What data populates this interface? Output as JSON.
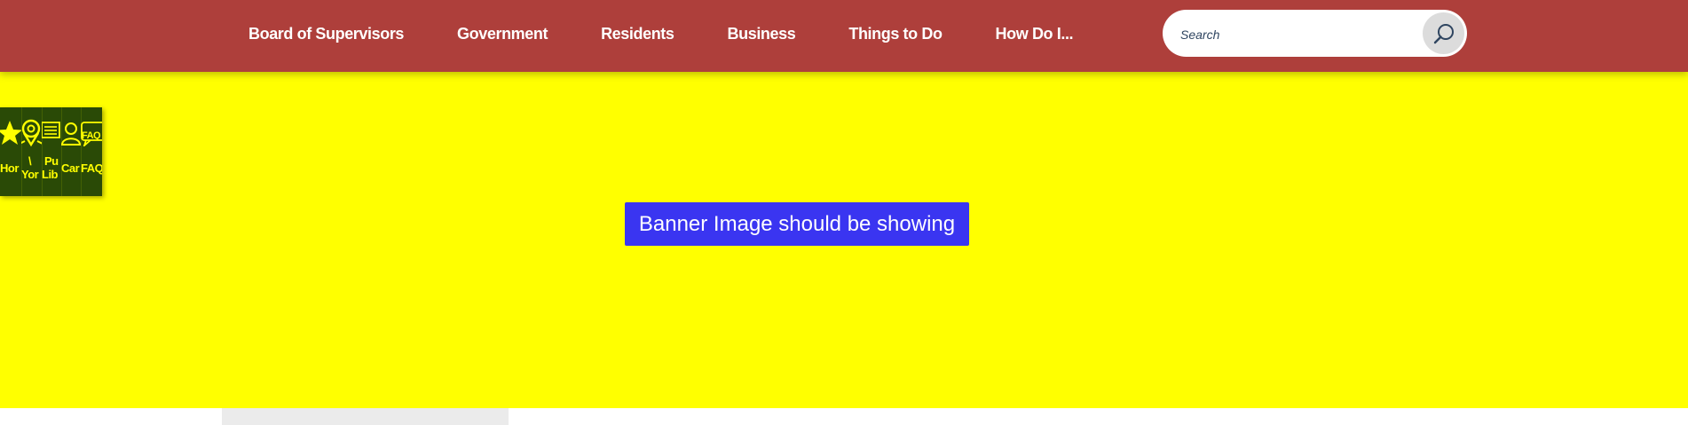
{
  "header": {
    "nav": [
      {
        "label": "Board of Supervisors"
      },
      {
        "label": "Government"
      },
      {
        "label": "Residents"
      },
      {
        "label": "Business"
      },
      {
        "label": "Things to Do"
      },
      {
        "label": "How Do I..."
      }
    ],
    "search": {
      "placeholder": "Search",
      "button_icon": "search-icon"
    },
    "colors": {
      "bar": "#ae3f3b",
      "search_button": "#dcdcdc"
    }
  },
  "banner": {
    "notice": "Banner Image should be showing",
    "colors": {
      "background": "#ffff00",
      "notice_background": "#3a35f1"
    }
  },
  "quick_links": {
    "colors": {
      "background": "#2a4a06",
      "foreground": "#ffff00"
    },
    "items": [
      {
        "icon": "star-icon",
        "label": "Hor"
      },
      {
        "icon": "map-pin-icon",
        "label_line1": "\\",
        "label_line2": "Yor"
      },
      {
        "icon": "book-icon",
        "label_line1": "Pu",
        "label_line2": "Lib"
      },
      {
        "icon": "person-icon",
        "label": "Car"
      },
      {
        "icon": "faq-icon",
        "icon_text": "FAQ",
        "label": "FAQ"
      }
    ]
  }
}
